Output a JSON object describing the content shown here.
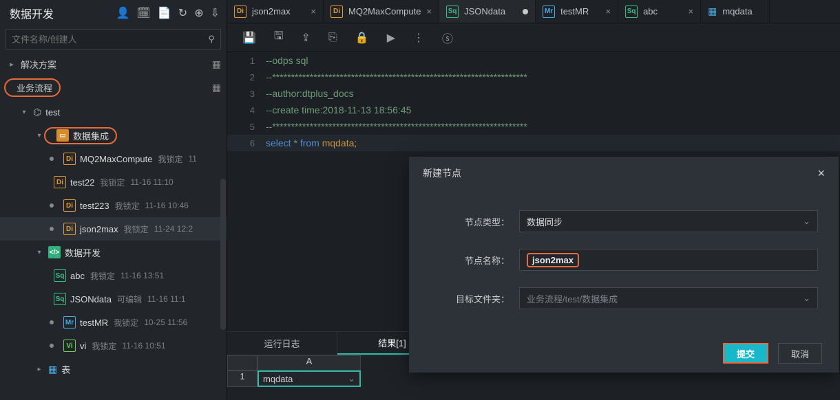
{
  "sidebar": {
    "title": "数据开发",
    "searchPlaceholder": "文件名称/创建人",
    "sections": {
      "solutions": "解决方案",
      "flows": "业务流程",
      "tables": "表"
    },
    "tree": {
      "root": "test",
      "integration": "数据集成",
      "dev": "数据开发",
      "items": [
        {
          "name": "MQ2MaxCompute",
          "meta": "我锁定",
          "time": "11"
        },
        {
          "name": "test22",
          "meta": "我锁定",
          "time": "11-16 11:10"
        },
        {
          "name": "test223",
          "meta": "我锁定",
          "time": "11-16 10:46"
        },
        {
          "name": "json2max",
          "meta": "我锁定",
          "time": "11-24 12:2"
        }
      ],
      "devItems": [
        {
          "kind": "Sq",
          "name": "abc",
          "meta": "我锁定",
          "time": "11-16 13:51"
        },
        {
          "kind": "Sq",
          "name": "JSONdata",
          "meta": "可编辑",
          "time": "11-16 11:1"
        },
        {
          "kind": "Mr",
          "name": "testMR",
          "meta": "我锁定",
          "time": "10-25 11:56"
        },
        {
          "kind": "Vi",
          "name": "vi",
          "meta": "我锁定",
          "time": "11-16 10:51"
        }
      ]
    }
  },
  "tabs": [
    {
      "kind": "Di",
      "label": "json2max",
      "state": "close"
    },
    {
      "kind": "Di",
      "label": "MQ2MaxCompute",
      "state": "close"
    },
    {
      "kind": "Sq",
      "label": "JSONdata",
      "state": "dirty",
      "active": true
    },
    {
      "kind": "Mr",
      "label": "testMR",
      "state": "close"
    },
    {
      "kind": "Sq",
      "label": "abc",
      "state": "close"
    },
    {
      "kind": "Tb",
      "label": "mqdata",
      "state": "none"
    }
  ],
  "code": {
    "l1": "--odps sql",
    "l2": "--********************************************************************",
    "l3": "--author:dtplus_docs",
    "l4": "--create time:2018-11-13 18:56:45",
    "l5": "--********************************************************************",
    "l6a": "select",
    "l6b": " * ",
    "l6c": "from",
    "l6d": " mqdata;"
  },
  "bottom": {
    "tab1": "运行日志",
    "tab2": "结果[1]",
    "colA": "A",
    "row1": "1",
    "cell": "mqdata"
  },
  "modal": {
    "title": "新建节点",
    "rows": {
      "type": {
        "label": "节点类型：",
        "value": "数据同步"
      },
      "name": {
        "label": "节点名称：",
        "value": "json2max"
      },
      "folder": {
        "label": "目标文件夹：",
        "placeholder": "业务流程/test/数据集成"
      }
    },
    "submit": "提交",
    "cancel": "取消"
  }
}
